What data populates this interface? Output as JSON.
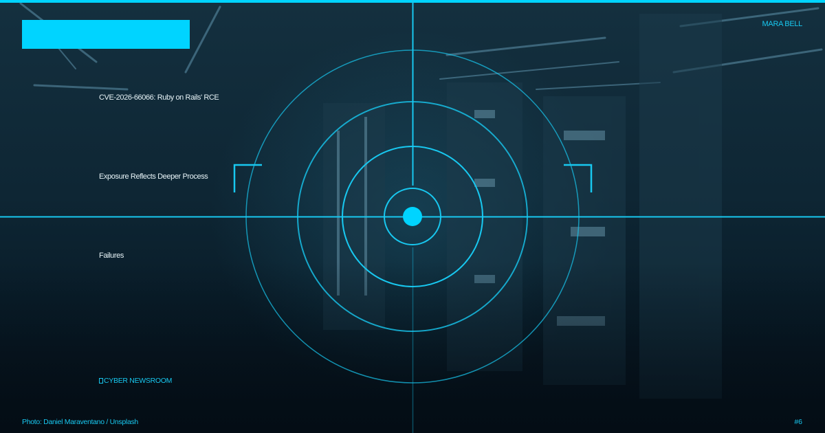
{
  "author": "MARA BELL",
  "headline_lines": [
    "CVE-2026-66066: Ruby on Rails' RCE",
    "Exposure Reflects Deeper Process",
    "Failures"
  ],
  "brand": {
    "icon": "newsroom-glyph-icon",
    "name": "CYBER NEWSROOM"
  },
  "photo_credit": "Photo: Daniel Maraventano / Unsplash",
  "page_number": "#6",
  "colors": {
    "accent": "#00d4ff",
    "text": "#e8f4f8",
    "background": "#0e2634"
  }
}
